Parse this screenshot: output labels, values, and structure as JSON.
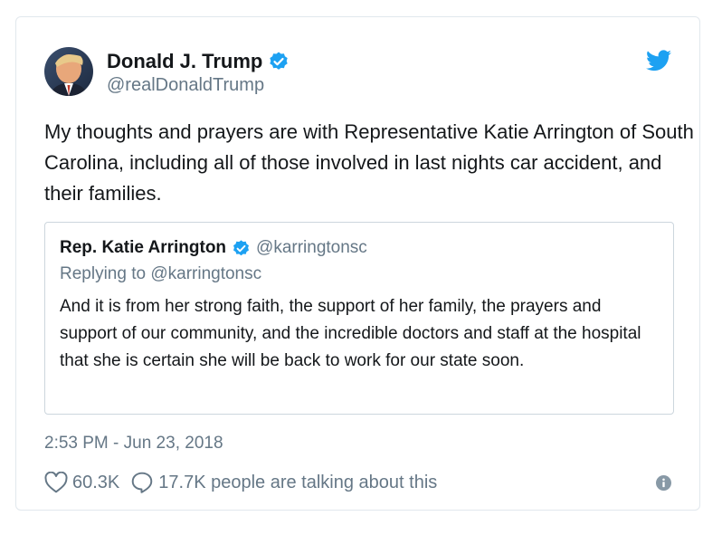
{
  "tweet": {
    "author": {
      "name": "Donald J. Trump",
      "handle": "@realDonaldTrump",
      "verified": true,
      "avatar_icon": "profile-photo"
    },
    "text": "My thoughts and prayers are with Representative Katie Arrington of South Carolina, including all of those involved in last nights car accident, and their families.",
    "quoted": {
      "name": "Rep. Katie Arrington",
      "handle": "@karringtonsc",
      "verified": true,
      "reply_prefix": "Replying to",
      "reply_handle": "@karringtonsc",
      "text": "And it is from her strong faith, the support of her family, the prayers and support of our community, and the incredible doctors and staff at the hospital that she is certain she will be back to work for our state soon."
    },
    "timestamp": "2:53 PM - Jun 23, 2018",
    "likes": "60.3K",
    "conversation": "17.7K people are talking about this"
  },
  "icons": {
    "bird": "twitter-bird-icon",
    "verified": "verified-badge-icon",
    "like": "heart-icon",
    "reply": "speech-bubble-icon",
    "info": "info-icon"
  },
  "colors": {
    "accent": "#1da1f2",
    "text": "#14171a",
    "secondary": "#657786",
    "border": "#e1e8ed"
  }
}
